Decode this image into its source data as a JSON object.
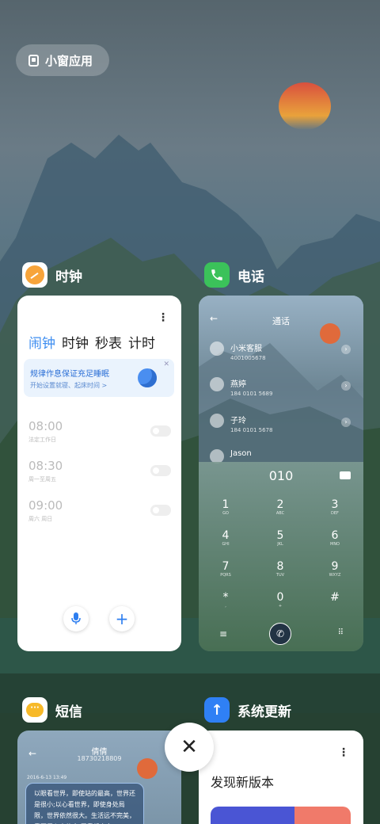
{
  "floating_window_button": {
    "label": "小窗应用"
  },
  "clock_app": {
    "name": "时钟",
    "tabs": [
      "闹钟",
      "时钟",
      "秒表",
      "计时"
    ],
    "promo_title": "规律作息保证充足睡眠",
    "promo_sub": "开始设置就寝、起床时间 >",
    "alarms": [
      {
        "time": "08:00",
        "label": "法定工作日"
      },
      {
        "time": "08:30",
        "label": "周一至周五"
      },
      {
        "time": "09:00",
        "label": "周六 周日"
      }
    ]
  },
  "phone_app": {
    "name": "电话",
    "title": "通话",
    "contacts": [
      {
        "name": "小米客服",
        "number": "4001005678"
      },
      {
        "name": "燕婷",
        "number": "184 0101 5689"
      },
      {
        "name": "子玲",
        "number": "184 0101 5678"
      },
      {
        "name": "Jason",
        "number": ""
      }
    ],
    "dialed": "010",
    "keys": [
      {
        "d": "1",
        "l": "GO"
      },
      {
        "d": "2",
        "l": "ABC"
      },
      {
        "d": "3",
        "l": "DEF"
      },
      {
        "d": "4",
        "l": "GHI"
      },
      {
        "d": "5",
        "l": "JKL"
      },
      {
        "d": "6",
        "l": "MNO"
      },
      {
        "d": "7",
        "l": "PQRS"
      },
      {
        "d": "8",
        "l": "TUV"
      },
      {
        "d": "9",
        "l": "WXYZ"
      },
      {
        "d": "*",
        "l": ","
      },
      {
        "d": "0",
        "l": "+"
      },
      {
        "d": "#",
        "l": ""
      }
    ]
  },
  "sms_app": {
    "name": "短信",
    "contact": "倩倩",
    "number": "18730218809",
    "date": "2016-6-13 13:49",
    "message": "以眼看世界，即使站的最高，世界还是很小;以心看世界，即使身处局限，世界依然很大。生活远不完美，需要用心去体会;无需想太多，"
  },
  "update_app": {
    "name": "系统更新",
    "heading": "发现新版本"
  },
  "colors": {
    "accent": "#3d8df0",
    "phone_green": "#3bc25a",
    "sms_yellow": "#f7b928",
    "update_blue": "#2f80f5",
    "clock_orange": "#f7a43a"
  }
}
